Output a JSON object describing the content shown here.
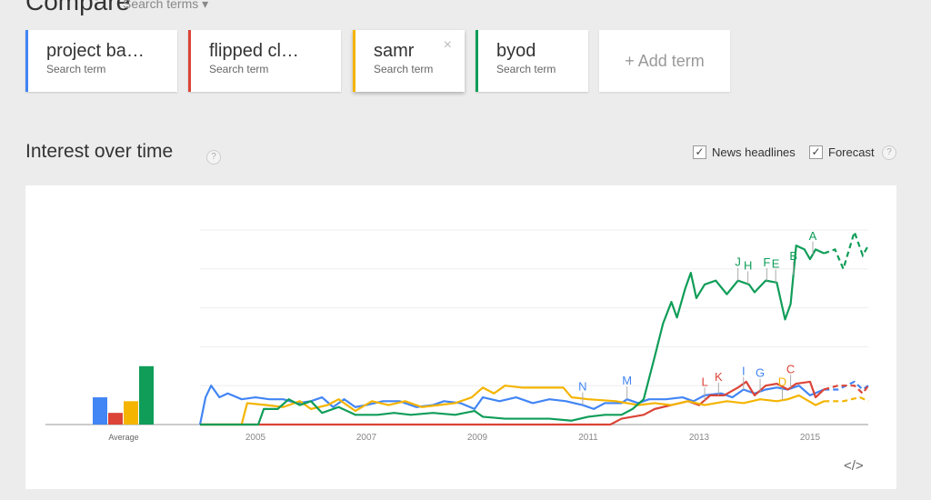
{
  "header": {
    "title": "Compare",
    "dropdown": "Search terms"
  },
  "terms": [
    {
      "label": "project ba…",
      "sub": "Search term",
      "color": "#4285f4"
    },
    {
      "label": "flipped cl…",
      "sub": "Search term",
      "color": "#db4437"
    },
    {
      "label": "samr",
      "sub": "Search term",
      "color": "#f4b400",
      "close": "×"
    },
    {
      "label": "byod",
      "sub": "Search term",
      "color": "#0f9d58"
    }
  ],
  "add_term": "+ Add term",
  "section": {
    "title": "Interest over time",
    "help": "?",
    "news": "News headlines",
    "forecast": "Forecast",
    "check": "✓",
    "embed": "</>"
  },
  "chart_data": {
    "type": "line",
    "xlim": [
      2004,
      2016.05
    ],
    "ylim": [
      0,
      100
    ],
    "grid": true,
    "x_ticks": [
      "2005",
      "2007",
      "2009",
      "2011",
      "2013",
      "2015"
    ],
    "average": {
      "label": "Average",
      "values": [
        14,
        6,
        12,
        30
      ]
    },
    "forecast_start": 2015.25,
    "series": [
      {
        "name": "project ba…",
        "color": "#4285f4",
        "points": [
          [
            2004,
            0
          ],
          [
            2004.1,
            14
          ],
          [
            2004.2,
            20
          ],
          [
            2004.35,
            14
          ],
          [
            2004.5,
            16
          ],
          [
            2004.75,
            13
          ],
          [
            2005,
            14
          ],
          [
            2005.25,
            13
          ],
          [
            2005.5,
            13
          ],
          [
            2005.75,
            11
          ],
          [
            2006,
            12
          ],
          [
            2006.2,
            14
          ],
          [
            2006.4,
            9
          ],
          [
            2006.6,
            13
          ],
          [
            2006.8,
            9
          ],
          [
            2007,
            10
          ],
          [
            2007.3,
            12
          ],
          [
            2007.6,
            12
          ],
          [
            2007.9,
            9
          ],
          [
            2008.2,
            10
          ],
          [
            2008.4,
            12
          ],
          [
            2008.7,
            11
          ],
          [
            2008.95,
            8
          ],
          [
            2009.1,
            14
          ],
          [
            2009.4,
            12
          ],
          [
            2009.7,
            14
          ],
          [
            2010,
            11
          ],
          [
            2010.3,
            13
          ],
          [
            2010.6,
            12
          ],
          [
            2010.9,
            10
          ],
          [
            2011.1,
            8
          ],
          [
            2011.3,
            11
          ],
          [
            2011.6,
            11
          ],
          [
            2011.7,
            13
          ],
          [
            2011.9,
            11
          ],
          [
            2012.1,
            13
          ],
          [
            2012.4,
            13
          ],
          [
            2012.7,
            14
          ],
          [
            2012.9,
            12
          ],
          [
            2013.1,
            15
          ],
          [
            2013.4,
            16
          ],
          [
            2013.6,
            14
          ],
          [
            2013.8,
            18
          ],
          [
            2014,
            16
          ],
          [
            2014.2,
            18
          ],
          [
            2014.4,
            19
          ],
          [
            2014.6,
            18
          ],
          [
            2014.8,
            20
          ],
          [
            2015,
            15
          ],
          [
            2015.25,
            18
          ],
          [
            2015.5,
            18
          ],
          [
            2015.8,
            22
          ],
          [
            2015.95,
            18
          ],
          [
            2016.05,
            20
          ]
        ]
      },
      {
        "name": "flipped cl…",
        "color": "#db4437",
        "points": [
          [
            2004,
            0
          ],
          [
            2011.4,
            0
          ],
          [
            2011.6,
            3
          ],
          [
            2011.8,
            4
          ],
          [
            2012,
            5
          ],
          [
            2012.2,
            8
          ],
          [
            2012.5,
            10
          ],
          [
            2012.8,
            12
          ],
          [
            2013,
            10
          ],
          [
            2013.2,
            15
          ],
          [
            2013.45,
            15
          ],
          [
            2013.7,
            19
          ],
          [
            2013.85,
            22
          ],
          [
            2014,
            15
          ],
          [
            2014.2,
            20
          ],
          [
            2014.4,
            21
          ],
          [
            2014.6,
            18
          ],
          [
            2014.75,
            21
          ],
          [
            2015,
            22
          ],
          [
            2015.1,
            14
          ],
          [
            2015.25,
            18
          ],
          [
            2015.5,
            20
          ],
          [
            2015.8,
            20
          ],
          [
            2015.95,
            16
          ],
          [
            2016.05,
            20
          ]
        ]
      },
      {
        "name": "samr",
        "color": "#f4b400",
        "points": [
          [
            2004,
            0
          ],
          [
            2004.75,
            0
          ],
          [
            2004.85,
            11
          ],
          [
            2005.2,
            10
          ],
          [
            2005.5,
            9
          ],
          [
            2005.8,
            12
          ],
          [
            2006,
            8
          ],
          [
            2006.3,
            10
          ],
          [
            2006.5,
            13
          ],
          [
            2006.8,
            7
          ],
          [
            2007.1,
            12
          ],
          [
            2007.4,
            10
          ],
          [
            2007.7,
            12
          ],
          [
            2008,
            9
          ],
          [
            2008.3,
            10
          ],
          [
            2008.6,
            11
          ],
          [
            2008.9,
            14
          ],
          [
            2009.1,
            19
          ],
          [
            2009.3,
            16
          ],
          [
            2009.5,
            20
          ],
          [
            2009.8,
            19
          ],
          [
            2010.2,
            19
          ],
          [
            2010.55,
            19
          ],
          [
            2010.7,
            14
          ],
          [
            2011,
            13
          ],
          [
            2011.5,
            12
          ],
          [
            2011.9,
            10
          ],
          [
            2012.2,
            11
          ],
          [
            2012.5,
            10
          ],
          [
            2012.8,
            12
          ],
          [
            2013.1,
            10
          ],
          [
            2013.5,
            12
          ],
          [
            2013.8,
            11
          ],
          [
            2014.1,
            13
          ],
          [
            2014.4,
            12
          ],
          [
            2014.6,
            13
          ],
          [
            2014.8,
            15
          ],
          [
            2015.1,
            10
          ],
          [
            2015.25,
            12
          ],
          [
            2015.6,
            12
          ],
          [
            2015.9,
            14
          ],
          [
            2016.05,
            12
          ]
        ]
      },
      {
        "name": "byod",
        "color": "#0f9d58",
        "points": [
          [
            2004,
            0
          ],
          [
            2005.05,
            0
          ],
          [
            2005.15,
            8
          ],
          [
            2005.4,
            8
          ],
          [
            2005.6,
            13
          ],
          [
            2005.8,
            10
          ],
          [
            2006,
            12
          ],
          [
            2006.2,
            6
          ],
          [
            2006.5,
            9
          ],
          [
            2006.8,
            5
          ],
          [
            2007.2,
            5
          ],
          [
            2007.5,
            6
          ],
          [
            2007.8,
            5
          ],
          [
            2008.2,
            6
          ],
          [
            2008.6,
            5
          ],
          [
            2008.95,
            7
          ],
          [
            2009.1,
            4
          ],
          [
            2009.5,
            3
          ],
          [
            2009.9,
            3
          ],
          [
            2010.3,
            3
          ],
          [
            2010.7,
            2
          ],
          [
            2011,
            4
          ],
          [
            2011.3,
            5
          ],
          [
            2011.6,
            5
          ],
          [
            2011.8,
            8
          ],
          [
            2012,
            13
          ],
          [
            2012.2,
            35
          ],
          [
            2012.35,
            52
          ],
          [
            2012.5,
            63
          ],
          [
            2012.6,
            55
          ],
          [
            2012.75,
            70
          ],
          [
            2012.85,
            78
          ],
          [
            2012.95,
            65
          ],
          [
            2013.1,
            72
          ],
          [
            2013.3,
            74
          ],
          [
            2013.5,
            67
          ],
          [
            2013.7,
            74
          ],
          [
            2013.9,
            72
          ],
          [
            2014,
            68
          ],
          [
            2014.2,
            74
          ],
          [
            2014.4,
            73
          ],
          [
            2014.55,
            54
          ],
          [
            2014.65,
            62
          ],
          [
            2014.75,
            92
          ],
          [
            2014.9,
            90
          ],
          [
            2015,
            85
          ],
          [
            2015.1,
            90
          ],
          [
            2015.25,
            88
          ],
          [
            2015.45,
            90
          ],
          [
            2015.6,
            80
          ],
          [
            2015.8,
            99
          ],
          [
            2015.95,
            87
          ],
          [
            2016.05,
            92
          ]
        ]
      }
    ],
    "annotations": [
      {
        "label": "N",
        "x": 2010.9,
        "series": 0
      },
      {
        "label": "M",
        "x": 2011.7,
        "series": 0
      },
      {
        "label": "L",
        "x": 2013.1,
        "series": 1
      },
      {
        "label": "K",
        "x": 2013.35,
        "series": 1
      },
      {
        "label": "I",
        "x": 2013.8,
        "series": 0
      },
      {
        "label": "G",
        "x": 2014.1,
        "series": 0
      },
      {
        "label": "D",
        "x": 2014.5,
        "series": 2
      },
      {
        "label": "C",
        "x": 2014.65,
        "series": 1
      },
      {
        "label": "J",
        "x": 2013.7,
        "series": 3
      },
      {
        "label": "H",
        "x": 2013.88,
        "series": 3
      },
      {
        "label": "F",
        "x": 2014.22,
        "series": 3
      },
      {
        "label": "E",
        "x": 2014.38,
        "series": 3
      },
      {
        "label": "B",
        "x": 2014.7,
        "series": 3
      },
      {
        "label": "A",
        "x": 2015.05,
        "series": 3
      }
    ]
  }
}
